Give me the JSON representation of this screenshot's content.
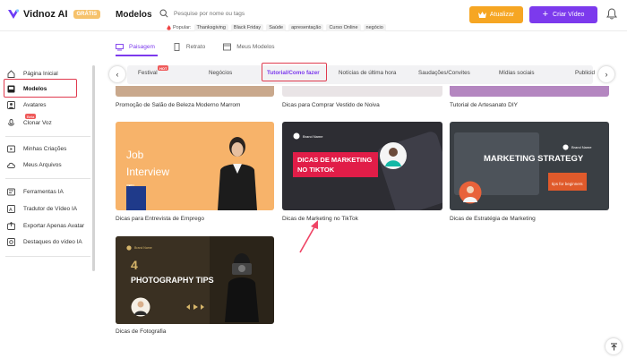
{
  "app": {
    "brand": "Vidnoz AI",
    "plan_badge": "GRÁTIS",
    "page_title": "Modelos"
  },
  "header": {
    "search_placeholder": "Pesquise por nome ou tags",
    "popular_label": "Popular:",
    "popular_tags": [
      "Thanksgiving",
      "Black Friday",
      "Saúde",
      "apresentação",
      "Curso Online",
      "negócio"
    ],
    "upgrade_label": "Atualizar",
    "create_label": "Criar Vídeo"
  },
  "subtabs": [
    {
      "label": "Paisagem",
      "active": true
    },
    {
      "label": "Retrato",
      "active": false
    },
    {
      "label": "Meus Modelos",
      "active": false
    }
  ],
  "sidebar": {
    "beta_badge": "Beta",
    "items": [
      {
        "label": "Página Inicial",
        "icon": "home-icon"
      },
      {
        "label": "Modelos",
        "icon": "templates-icon",
        "active": true
      },
      {
        "label": "Avatares",
        "icon": "avatar-icon"
      },
      {
        "label": "Clonar Voz",
        "icon": "voice-icon"
      },
      {
        "label": "Minhas Criações",
        "icon": "video-icon"
      },
      {
        "label": "Meus Arquivos",
        "icon": "cloud-icon"
      },
      {
        "label": "Ferramentas IA",
        "icon": "tools-icon"
      },
      {
        "label": "Tradutor de Vídeo IA",
        "icon": "translate-icon"
      },
      {
        "label": "Exportar Apenas Avatar",
        "icon": "export-icon"
      },
      {
        "label": "Destaques do vídeo IA",
        "icon": "highlight-icon"
      }
    ]
  },
  "categories": {
    "hot_badge": "HOT",
    "items": [
      "Festival",
      "Negócios",
      "Tutorial/Como fazer",
      "Notícias de última hora",
      "Saudações/Convites",
      "Mídias sociais",
      "Publicid"
    ],
    "active": "Tutorial/Como fazer"
  },
  "cards": {
    "top_row": [
      "Promoção de Salão de Beleza Moderno Marrom",
      "Dicas para Comprar Vestido de Noiva",
      "Tutorial de Artesanato DIY"
    ],
    "middle_row": [
      {
        "title": "Dicas para Entrevista de Emprego",
        "thumb_text": "Job Interview Tips"
      },
      {
        "title": "Dicas de Marketing no TikTok",
        "thumb_text": "DICAS DE MARKETING NO TIKTOK",
        "brand": "Brand Name"
      },
      {
        "title": "Dicas de Estratégia de Marketing",
        "thumb_text": "MARKETING STRATEGY",
        "thumb_sub": "tips for beginners",
        "brand": "Brand Name"
      }
    ],
    "bottom_row": [
      {
        "title": "Dicas de Fotografia",
        "thumb_text": "PHOTOGRAPHY TIPS",
        "thumb_number": "4",
        "brand": "Brand Name"
      }
    ]
  },
  "colors": {
    "accent": "#7c3aed",
    "upgrade": "#f6a623",
    "highlight": "#e03a4e"
  }
}
